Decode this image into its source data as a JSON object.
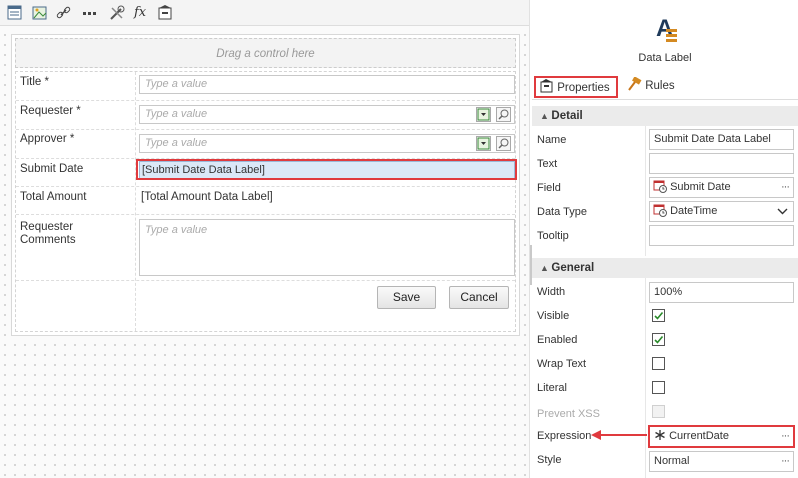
{
  "designer": {
    "drag_hint": "Drag a control here",
    "fields": [
      {
        "label": "Title *",
        "placeholder": "Type a value"
      },
      {
        "label": "Requester *",
        "placeholder": "Type a value"
      },
      {
        "label": "Approver *",
        "placeholder": "Type a value"
      },
      {
        "label": "Submit Date",
        "value": "[Submit Date Data Label]"
      },
      {
        "label": "Total Amount",
        "value": "[Total Amount Data Label]"
      },
      {
        "label": "Requester Comments",
        "placeholder": "Type a value"
      }
    ],
    "buttons": {
      "save": "Save",
      "cancel": "Cancel"
    }
  },
  "toolbar": {
    "icons": [
      "form-icon",
      "image-edit-icon",
      "link-icon",
      "more-icon",
      "tools-icon",
      "fx-icon",
      "style-icon"
    ]
  },
  "properties_pane": {
    "control_name": "Data Label",
    "tabs": {
      "properties": "Properties",
      "rules": "Rules"
    },
    "sections": {
      "detail": "Detail",
      "general": "General"
    },
    "detail": {
      "name_label": "Name",
      "name_value": "Submit Date Data Label",
      "text_label": "Text",
      "text_value": "",
      "field_label": "Field",
      "field_value": "Submit Date",
      "data_type_label": "Data Type",
      "data_type_value": "DateTime",
      "tooltip_label": "Tooltip",
      "tooltip_value": ""
    },
    "general": {
      "width_label": "Width",
      "width_value": "100%",
      "visible_label": "Visible",
      "visible": true,
      "enabled_label": "Enabled",
      "enabled": true,
      "wrap_text_label": "Wrap Text",
      "wrap_text": false,
      "literal_label": "Literal",
      "literal": false,
      "prevent_xss_label": "Prevent XSS",
      "prevent_xss": false,
      "expression_label": "Expression",
      "expression_value": "CurrentDate",
      "style_label": "Style",
      "style_value": "Normal"
    },
    "ellipsis": "···"
  },
  "colors": {
    "highlight": "#e03a3e",
    "accent_blue": "#1a5fa8",
    "selected_fill": "#dbe8f7"
  }
}
